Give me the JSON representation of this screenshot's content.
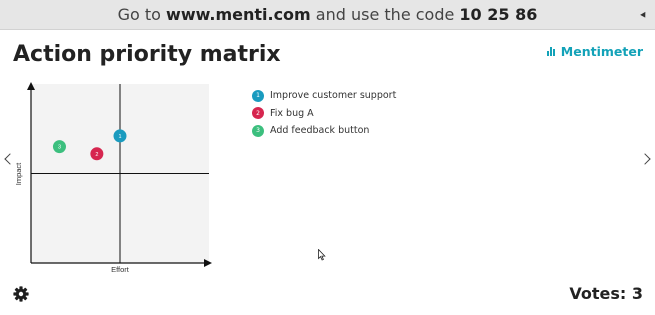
{
  "banner": {
    "prefix": "Go to ",
    "url": "www.menti.com",
    "middle": " and use the code ",
    "code": "10 25 86"
  },
  "slide": {
    "title": "Action priority matrix",
    "brand": "Mentimeter",
    "votes_text": "Votes: 3"
  },
  "chart_data": {
    "type": "scatter",
    "xlabel": "Effort",
    "ylabel": "Impact",
    "xlim": [
      0,
      10
    ],
    "ylim": [
      0,
      10
    ],
    "grid": false,
    "quadrant_dividers": {
      "x": 5,
      "y": 5
    },
    "points": [
      {
        "id": "1",
        "label": "Improve customer support",
        "x": 5.0,
        "y": 7.1,
        "color": "#1a9bbf"
      },
      {
        "id": "2",
        "label": "Fix bug A",
        "x": 3.7,
        "y": 6.1,
        "color": "#d6264f"
      },
      {
        "id": "3",
        "label": "Add feedback button",
        "x": 1.6,
        "y": 6.5,
        "color": "#3cbf7e"
      }
    ]
  },
  "icons": {
    "settings": "gear-icon",
    "prev": "chevron-left-icon",
    "next": "chevron-right-icon",
    "collapse": "collapse-arrow-icon",
    "cursor": "mouse-cursor-icon"
  },
  "colors": {
    "brand": "#13a2b8",
    "banner_bg": "#e6e6e6",
    "plot_bg": "#f3f3f3"
  }
}
